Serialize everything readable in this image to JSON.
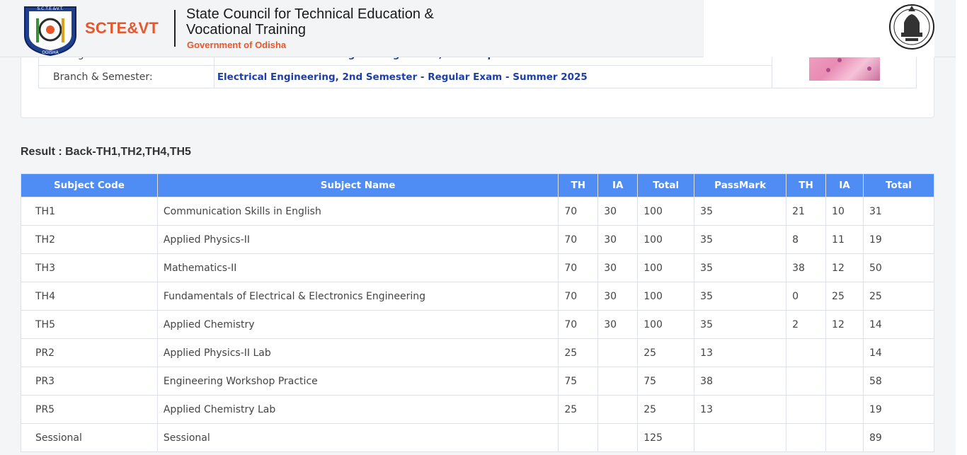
{
  "header": {
    "brand": "SCTE&VT",
    "council_name": "State Council for Technical Education &\nVocational Training",
    "government": "Government of Odisha",
    "logo_icon": "scte-vt-logo-icon",
    "emblem_icon": "odisha-emblem-icon"
  },
  "info": {
    "college_label": "College:",
    "college_value": "Uma Charan Pattnaik Engineering School, Berhampur",
    "branch_label": "Branch & Semester:",
    "branch_value": "Electrical Engineering, 2nd Semester - Regular Exam - Summer 2025"
  },
  "result": {
    "heading": "Result : Back-TH1,TH2,TH4,TH5"
  },
  "table": {
    "headers": [
      "Subject Code",
      "Subject Name",
      "TH",
      "IA",
      "Total",
      "PassMark",
      "TH",
      "IA",
      "Total"
    ],
    "rows": [
      [
        "TH1",
        "Communication Skills in English",
        "70",
        "30",
        "100",
        "35",
        "21",
        "10",
        "31"
      ],
      [
        "TH2",
        "Applied Physics-II",
        "70",
        "30",
        "100",
        "35",
        "8",
        "11",
        "19"
      ],
      [
        "TH3",
        "Mathematics-II",
        "70",
        "30",
        "100",
        "35",
        "38",
        "12",
        "50"
      ],
      [
        "TH4",
        "Fundamentals of Electrical & Electronics Engineering",
        "70",
        "30",
        "100",
        "35",
        "0",
        "25",
        "25"
      ],
      [
        "TH5",
        "Applied Chemistry",
        "70",
        "30",
        "100",
        "35",
        "2",
        "12",
        "14"
      ],
      [
        "PR2",
        "Applied Physics-II Lab",
        "25",
        "",
        "25",
        "13",
        "",
        "",
        "14"
      ],
      [
        "PR3",
        "Engineering Workshop Practice",
        "75",
        "",
        "75",
        "38",
        "",
        "",
        "58"
      ],
      [
        "PR5",
        "Applied Chemistry Lab",
        "25",
        "",
        "25",
        "13",
        "",
        "",
        "19"
      ],
      [
        "Sessional",
        "Sessional",
        "",
        "",
        "125",
        "",
        "",
        "",
        "89"
      ]
    ]
  },
  "colors": {
    "table_header_bg": "#4f8df5",
    "brand_orange": "#e8562a",
    "value_blue": "#1e3fa8"
  }
}
